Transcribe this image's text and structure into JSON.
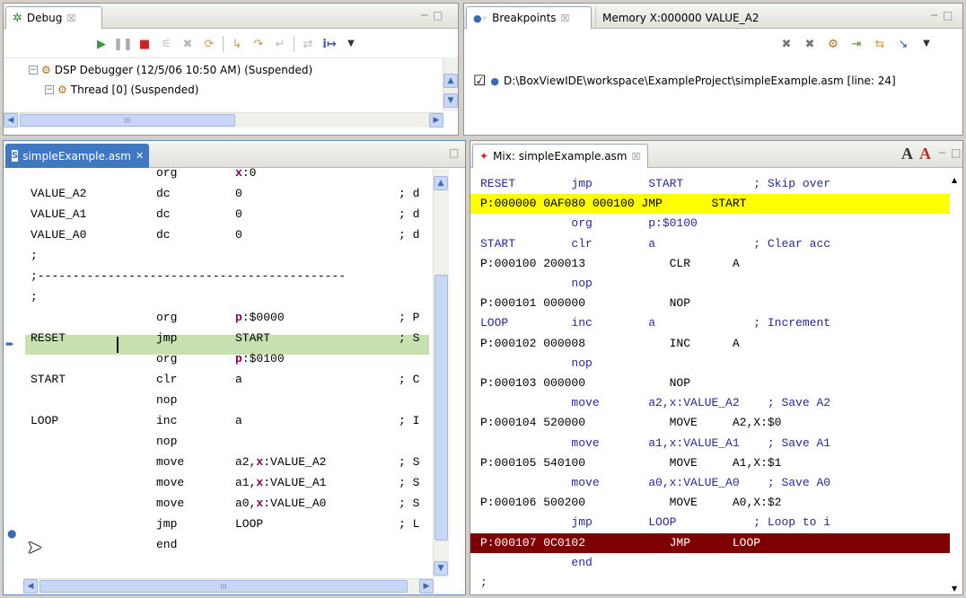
{
  "debug_view": {
    "tab_label": "Debug",
    "tab_close": "☒",
    "window_buttons": "─ □",
    "tree": [
      {
        "label": "DSP Debugger (12/5/06 10:50 AM) (Suspended)"
      },
      {
        "label": "Thread [0] (Suspended)"
      }
    ],
    "hscroll_label": "III"
  },
  "breakpoints_view": {
    "tab_label": "Breakpoints",
    "tab_close": "☒",
    "memory_tab_label": "Memory X:000000 VALUE_A2",
    "window_buttons": "─ □",
    "entries": [
      {
        "checked": "☑",
        "path": "D:\\BoxViewIDE\\workspace\\ExampleProject\\simpleExample.asm [line: 24]"
      }
    ]
  },
  "editor": {
    "tab_label": "simpleExample.asm",
    "tab_close": "✕",
    "window_button": "□",
    "hscroll_label": "III",
    "lines": [
      {
        "label": "",
        "op": "org",
        "operand_kw": "x",
        "operand_rest": ":0",
        "comment": ""
      },
      {
        "label": "VALUE_A2",
        "op": "dc",
        "operand_kw": "",
        "operand_rest": "0",
        "comment": "; d"
      },
      {
        "label": "VALUE_A1",
        "op": "dc",
        "operand_kw": "",
        "operand_rest": "0",
        "comment": "; d"
      },
      {
        "label": "VALUE_A0",
        "op": "dc",
        "operand_kw": "",
        "operand_rest": "0",
        "comment": "; d"
      },
      {
        "label": ";",
        "op": "",
        "operand_kw": "",
        "operand_rest": "",
        "comment": ""
      },
      {
        "label": ";--------------------------------------------",
        "op": "",
        "operand_kw": "",
        "operand_rest": "",
        "comment": ""
      },
      {
        "label": ";",
        "op": "",
        "operand_kw": "",
        "operand_rest": "",
        "comment": ""
      },
      {
        "label": "",
        "op": "org",
        "operand_kw": "p",
        "operand_rest": ":$0000",
        "comment": "; P"
      },
      {
        "label": "RESET",
        "op": "jmp",
        "operand_kw": "",
        "operand_rest": "START",
        "comment": "; S"
      },
      {
        "label": "",
        "op": "org",
        "operand_kw": "p",
        "operand_rest": ":$0100",
        "comment": ""
      },
      {
        "label": "START",
        "op": "clr",
        "operand_kw": "",
        "operand_rest": "a",
        "comment": "; C"
      },
      {
        "label": "",
        "op": "nop",
        "operand_kw": "",
        "operand_rest": "",
        "comment": ""
      },
      {
        "label": "LOOP",
        "op": "inc",
        "operand_kw": "",
        "operand_rest": "a",
        "comment": "; I"
      },
      {
        "label": "",
        "op": "nop",
        "operand_kw": "",
        "operand_rest": "",
        "comment": ""
      },
      {
        "label": "",
        "op": "move",
        "operand_kw": "x",
        "operand_pre": "a2,",
        "operand_rest": ":VALUE_A2",
        "comment": "; S"
      },
      {
        "label": "",
        "op": "move",
        "operand_kw": "x",
        "operand_pre": "a1,",
        "operand_rest": ":VALUE_A1",
        "comment": "; S"
      },
      {
        "label": "",
        "op": "move",
        "operand_kw": "x",
        "operand_pre": "a0,",
        "operand_rest": ":VALUE_A0",
        "comment": "; S"
      },
      {
        "label": "",
        "op": "jmp",
        "operand_kw": "",
        "operand_rest": "LOOP",
        "comment": "; L"
      },
      {
        "label": "",
        "op": "end",
        "operand_kw": "",
        "operand_rest": "",
        "comment": ""
      }
    ]
  },
  "mix_view": {
    "tab_label": "Mix: simpleExample.asm",
    "tab_close": "☒",
    "toolbar_icon_a": "A",
    "toolbar_icon_ax": "A",
    "window_buttons": "─ □",
    "lines": [
      {
        "text": "RESET        jmp        START          ; Skip over",
        "style": "src"
      },
      {
        "text": "P:000000 0AF080 000100 JMP       START",
        "style": "pc"
      },
      {
        "text": "             org        p:$0100",
        "style": "src"
      },
      {
        "text": "START        clr        a              ; Clear acc",
        "style": "src"
      },
      {
        "text": "P:000100 200013            CLR      A",
        "style": "dis"
      },
      {
        "text": "             nop",
        "style": "src"
      },
      {
        "text": "P:000101 000000            NOP",
        "style": "dis"
      },
      {
        "text": "LOOP         inc        a              ; Increment",
        "style": "src"
      },
      {
        "text": "P:000102 000008            INC      A",
        "style": "dis"
      },
      {
        "text": "             nop",
        "style": "src"
      },
      {
        "text": "P:000103 000000            NOP",
        "style": "dis"
      },
      {
        "text": "             move       a2,x:VALUE_A2    ; Save A2",
        "style": "src"
      },
      {
        "text": "P:000104 520000            MOVE     A2,X:$0",
        "style": "dis"
      },
      {
        "text": "             move       a1,x:VALUE_A1    ; Save A1",
        "style": "src"
      },
      {
        "text": "P:000105 540100            MOVE     A1,X:$1",
        "style": "dis"
      },
      {
        "text": "             move       a0,x:VALUE_A0    ; Save A0",
        "style": "src"
      },
      {
        "text": "P:000106 500200            MOVE     A0,X:$2",
        "style": "dis"
      },
      {
        "text": "             jmp        LOOP           ; Loop to i",
        "style": "src"
      },
      {
        "text": "P:000107 0C0102            JMP      LOOP",
        "style": "bp"
      },
      {
        "text": "             end",
        "style": "src"
      },
      {
        "text": ";",
        "style": "src"
      }
    ]
  },
  "colors": {
    "pc_highlight": "#ffff00",
    "bp_highlight": "#7f0000",
    "current_line": "#c8e0b0",
    "directive": "#2a2a8a"
  }
}
